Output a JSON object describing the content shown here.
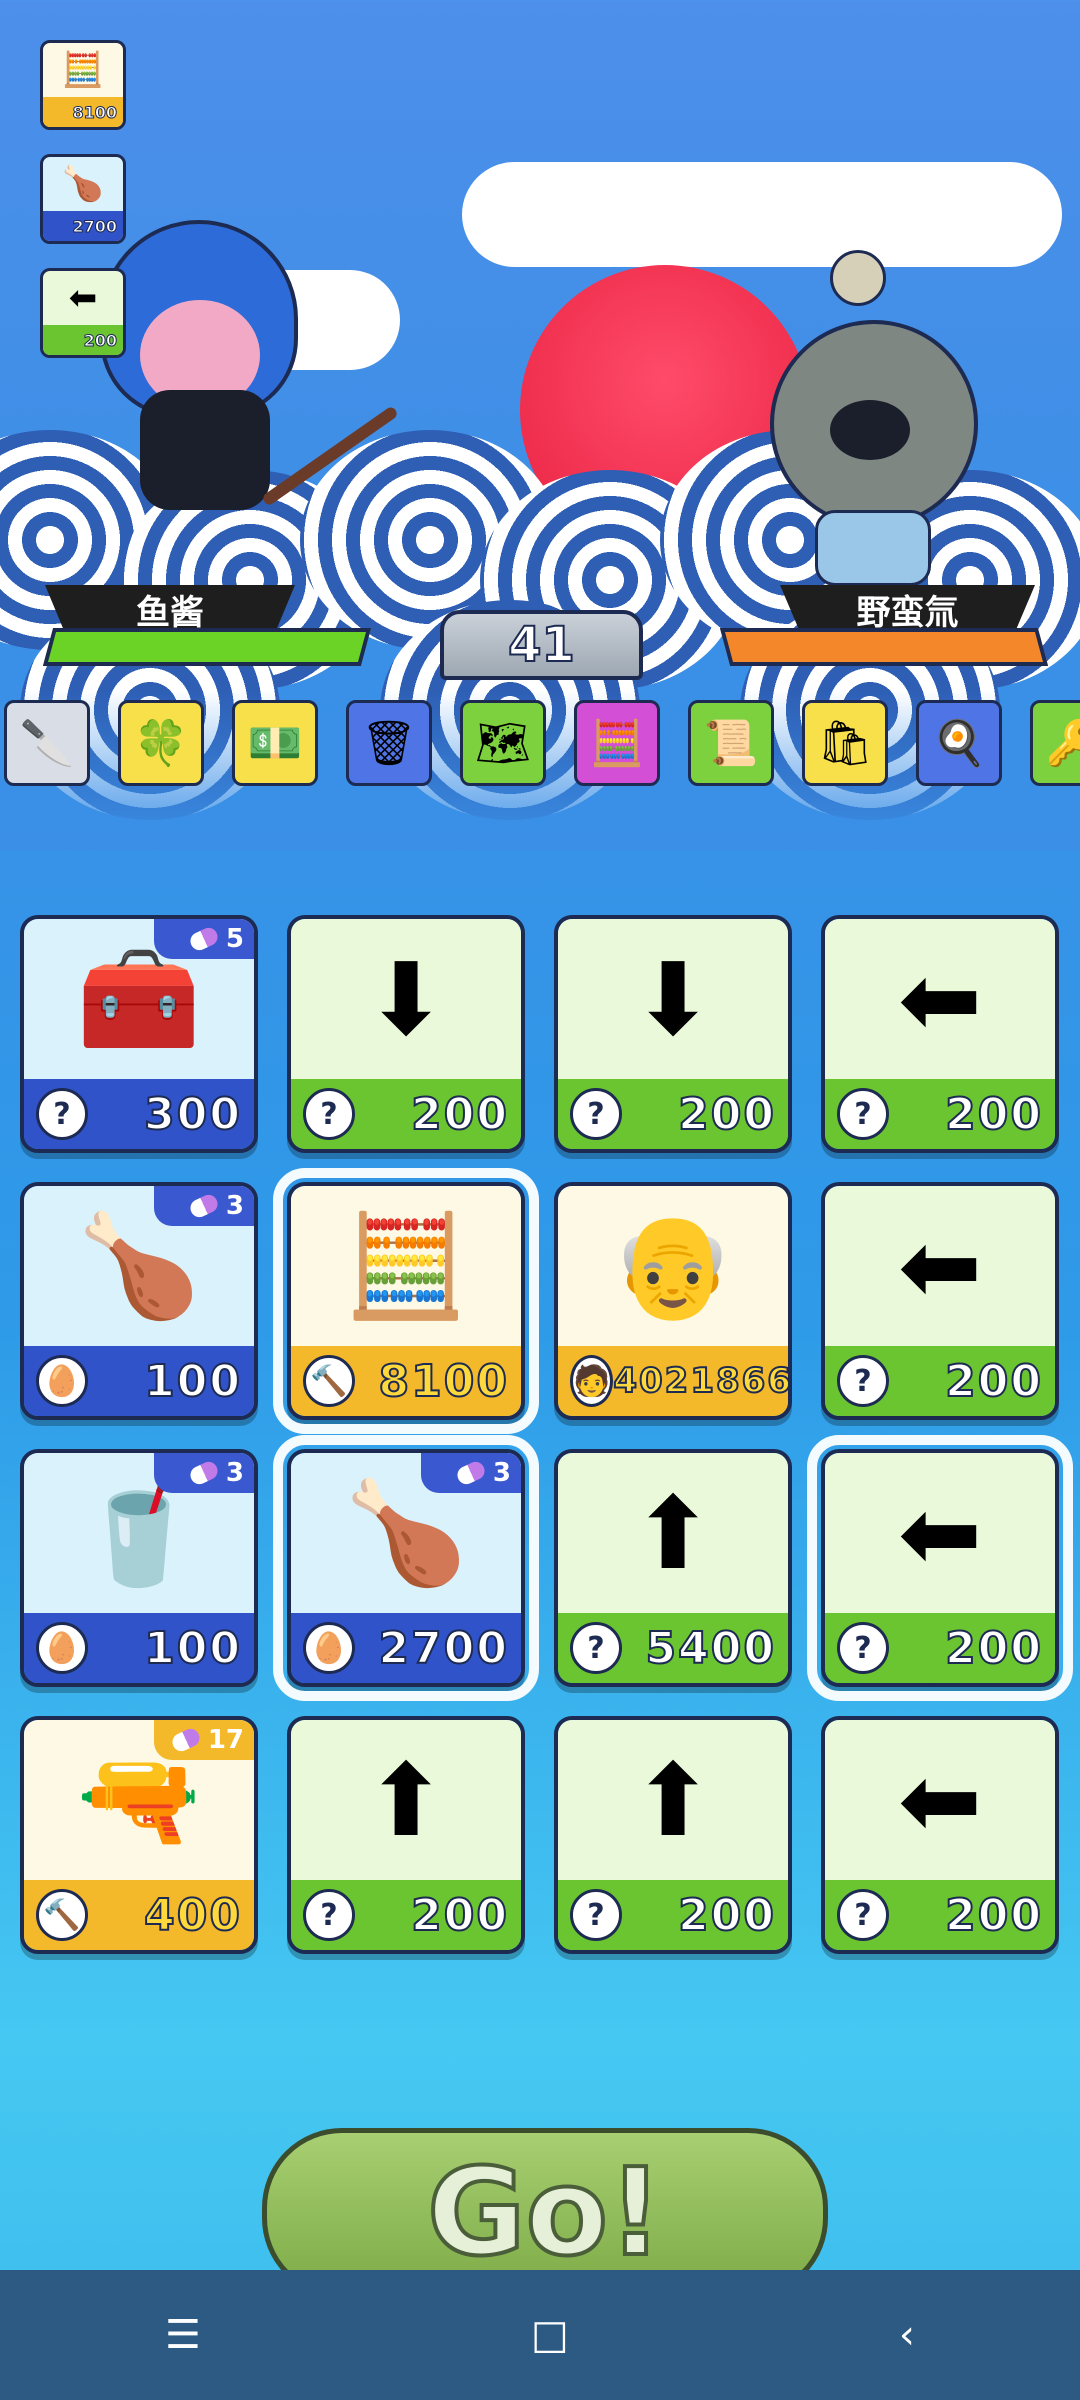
{
  "hud": {
    "items": [
      {
        "icon": "abacus-icon",
        "glyph": "🧮",
        "value": "8100",
        "tone": "gold"
      },
      {
        "icon": "chicken-leg-icon",
        "glyph": "🍗",
        "value": "2700",
        "tone": "blue"
      },
      {
        "icon": "left-arrow-icon",
        "glyph": "⬅",
        "value": "200",
        "tone": "green"
      }
    ]
  },
  "battle": {
    "player_name": "鱼酱",
    "enemy_name": "野蛮氚",
    "round": "41",
    "player_bar_color": "#6ad326",
    "enemy_bar_color": "#f4872a"
  },
  "strip": [
    {
      "icon": "cleaver-icon",
      "glyph": "🔪",
      "bg": "#d8dde6"
    },
    {
      "icon": "clover-icon",
      "glyph": "🍀",
      "bg": "#f7e04a"
    },
    {
      "icon": "cash-box-icon",
      "glyph": "💵",
      "bg": "#f7e04a"
    },
    {
      "icon": "trash-can-icon",
      "glyph": "🗑",
      "bg": "#4f74e6"
    },
    {
      "icon": "map-icon",
      "glyph": "🗺",
      "bg": "#7dd13e"
    },
    {
      "icon": "calculator-icon",
      "glyph": "🧮",
      "bg": "#d24fd6"
    },
    {
      "icon": "certificate-icon",
      "glyph": "📜",
      "bg": "#7dd13e"
    },
    {
      "icon": "shopping-bag-icon",
      "glyph": "🛍",
      "bg": "#f7e04a"
    },
    {
      "icon": "frying-pan-icon",
      "glyph": "🍳",
      "bg": "#4f74e6"
    },
    {
      "icon": "key-icon",
      "glyph": "🔑",
      "bg": "#7dd13e"
    }
  ],
  "shop": {
    "rows": [
      [
        {
          "type": "blue",
          "icon": "treasure-chest-icon",
          "glyph": "🧰",
          "badge": "5",
          "currency": "?",
          "price": "300"
        },
        {
          "type": "green",
          "icon": "down-arrow-icon",
          "glyph": "⬇",
          "currency": "?",
          "price": "200"
        },
        {
          "type": "green",
          "icon": "down-arrow-icon",
          "glyph": "⬇",
          "currency": "?",
          "price": "200"
        },
        {
          "type": "green",
          "icon": "left-arrow-icon",
          "glyph": "⬅",
          "currency": "?",
          "price": "200"
        }
      ],
      [
        {
          "type": "blue",
          "icon": "chicken-leg-icon",
          "glyph": "🍗",
          "badge": "3",
          "currency": "🥚",
          "price": "100"
        },
        {
          "type": "gold",
          "icon": "abacus-icon",
          "glyph": "🧮",
          "currency": "🔨",
          "price": "8100",
          "highlight": true
        },
        {
          "type": "gold",
          "icon": "scientist-icon",
          "glyph": "👴",
          "currency": "🧑",
          "price": "4021866"
        },
        {
          "type": "green",
          "icon": "left-arrow-icon",
          "glyph": "⬅",
          "currency": "?",
          "price": "200"
        }
      ],
      [
        {
          "type": "blue",
          "icon": "cola-bottle-icon",
          "glyph": "🥤",
          "badge": "3",
          "currency": "🥚",
          "price": "100"
        },
        {
          "type": "blue",
          "icon": "chicken-leg-icon",
          "glyph": "🍗",
          "badge": "3",
          "currency": "🥚",
          "price": "2700",
          "highlight": true
        },
        {
          "type": "green",
          "icon": "up-arrow-icon",
          "glyph": "⬆",
          "currency": "?",
          "price": "5400"
        },
        {
          "type": "green",
          "icon": "left-arrow-icon",
          "glyph": "⬅",
          "currency": "?",
          "price": "200",
          "highlight": true
        }
      ],
      [
        {
          "type": "gold",
          "icon": "gatling-gun-icon",
          "glyph": "🔫",
          "badge": "17",
          "currency": "🔨",
          "price": "400"
        },
        {
          "type": "green",
          "icon": "up-arrow-icon",
          "glyph": "⬆",
          "currency": "?",
          "price": "200"
        },
        {
          "type": "green",
          "icon": "up-arrow-icon",
          "glyph": "⬆",
          "currency": "?",
          "price": "200"
        },
        {
          "type": "green",
          "icon": "left-arrow-icon",
          "glyph": "⬅",
          "currency": "?",
          "price": "200"
        }
      ]
    ]
  },
  "go_button": "Go!",
  "nav": {
    "menu": "☰",
    "home": "□",
    "back": "‹"
  }
}
